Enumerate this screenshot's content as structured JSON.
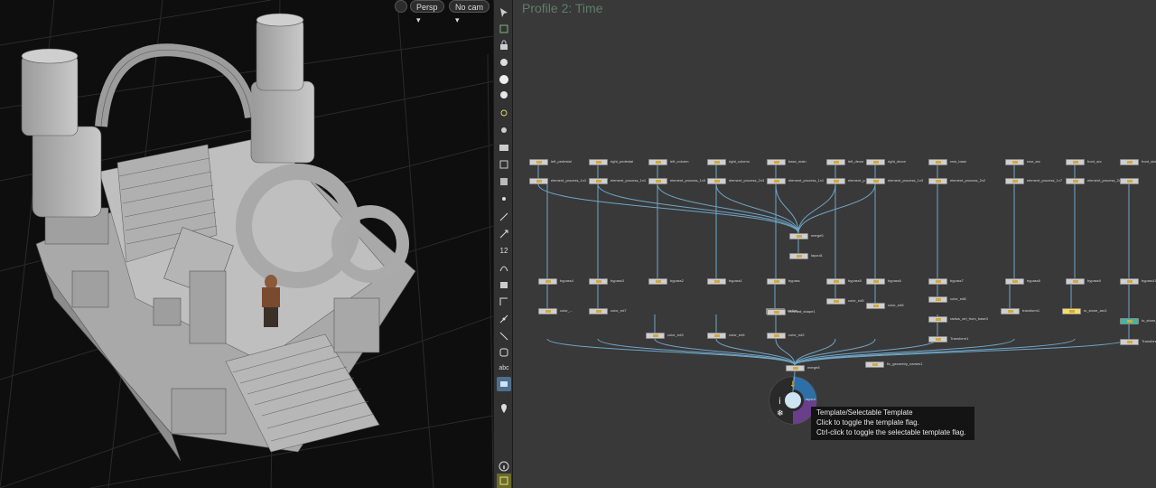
{
  "viewport": {
    "view_menu": "Persp ▾",
    "camera_menu": "No cam ▾"
  },
  "toolbar": {
    "items": [
      "select-icon",
      "transform-icon",
      "lock-icon",
      "light-icon",
      "shading-icon",
      "display-icon",
      "bulb-icon",
      "eye-light-icon",
      "snapshot-icon",
      "camera-icon",
      "cube-icon",
      "dot-icon",
      "pick-icon",
      "normal-icon",
      "number-icon",
      "wire-icon",
      "measure-icon",
      "corner-icon",
      "guide-icon",
      "link-icon",
      "record-icon",
      "abc-icon",
      "screen-icon",
      "pin-icon",
      "info-icon",
      "grid-icon"
    ],
    "abc_label": "abc",
    "number_label": "12"
  },
  "network": {
    "title": "Profile 2: Time",
    "row1": [
      "left_pedestal",
      "right_pedestal",
      "left_column",
      "right_column",
      "base_main",
      "left_decor",
      "right_decor",
      "rear_base",
      "rear_arc",
      "front_arc",
      "front_stai"
    ],
    "row2": [
      "element_process_1x1",
      "element_process_1x1",
      "element_process_1x3",
      "element_process_2x3",
      "element_process_1x1",
      "element_p...",
      "element_process_1x3",
      "element_process_2x2",
      "element_process_1x7",
      "element_process_2x4"
    ],
    "merge_label": "merge5",
    "layout_label": "layout1",
    "row3": [
      "bypass4",
      "bypass3",
      "bypass2",
      "bypass1",
      "bypass",
      "bypass5",
      "bypass6",
      "bypass7",
      "bypass8",
      "bypass9",
      "bypass10"
    ],
    "row4": [
      "color_...",
      "color_ed7",
      "color_ed5",
      "color_ed6",
      "color_ed8",
      "transform1",
      "to_stone_arc3",
      "to_stone_arc4",
      "radius_..."
    ],
    "row5": [
      "color_ed3",
      "color_ed4",
      "color_ed2",
      "Transform1",
      "radius_ctrl_from_base3",
      "Transform3"
    ],
    "final_merge": "merge8",
    "extra_node": "fix_geometry_names1",
    "center_node": "layout",
    "mid_label": "meshed_shape1"
  },
  "tooltip": {
    "line1": "Template/Selectable Template",
    "line2": "Click to toggle the template flag.",
    "line3": "Ctrl-click to toggle the selectable template flag."
  },
  "colors": {
    "viewport_bg": "#0e0e0e",
    "network_bg": "#393939",
    "wire": "#6fa6c7",
    "title": "#5f7d6c",
    "selected_node": "#f4e15a",
    "teal_node": "#3cb8a0"
  }
}
